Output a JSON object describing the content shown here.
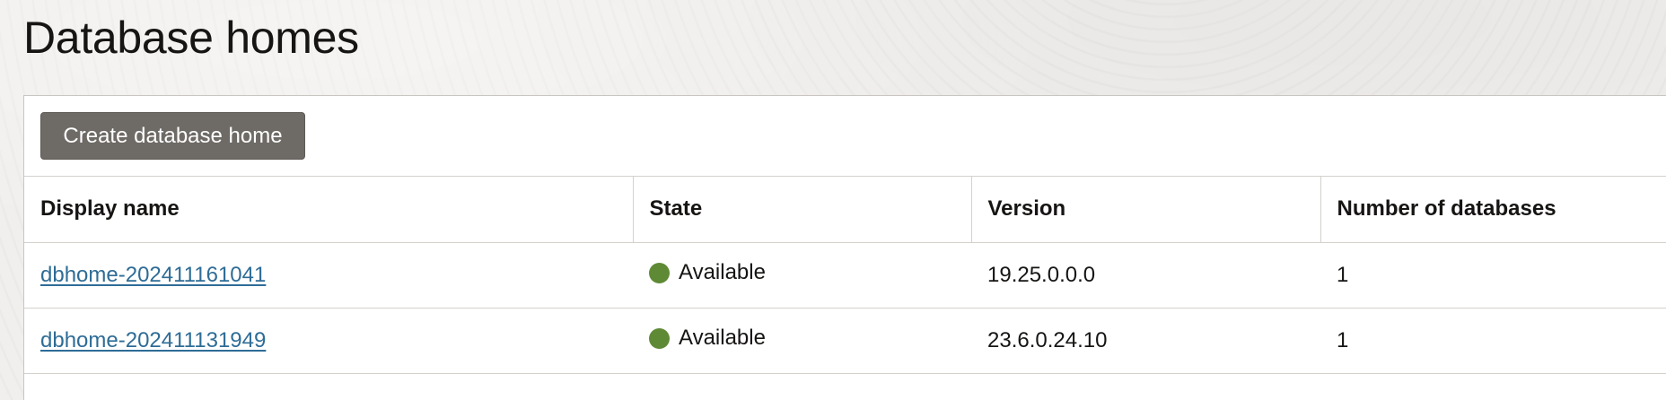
{
  "page": {
    "title": "Database homes"
  },
  "toolbar": {
    "create_label": "Create database home"
  },
  "table": {
    "columns": [
      "Display name",
      "State",
      "Version",
      "Number of databases"
    ],
    "rows": [
      {
        "display_name": "dbhome-202411161041",
        "state": "Available",
        "version": "19.25.0.0.0",
        "num_databases": "1"
      },
      {
        "display_name": "dbhome-202411131949",
        "state": "Available",
        "version": "23.6.0.24.10",
        "num_databases": "1"
      }
    ]
  },
  "colors": {
    "available": "#5f8a35",
    "link": "#2e6c96",
    "button_bg": "#6e6a66"
  },
  "icons": {
    "status": "status-dot-icon"
  }
}
